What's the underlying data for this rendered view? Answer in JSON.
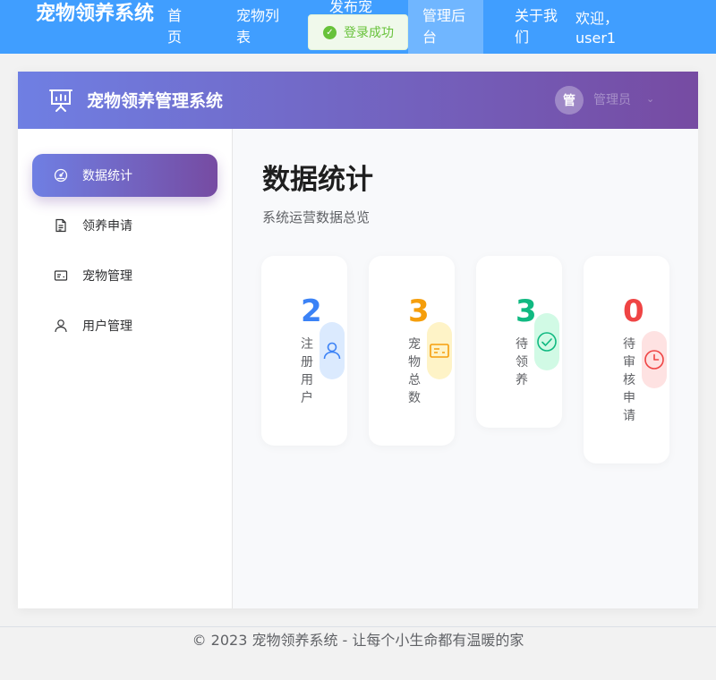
{
  "topbar": {
    "brand": "宠物领养系统",
    "nav": {
      "home": "首页",
      "pet_list": "宠物列表",
      "post_pet": "发布宠",
      "admin": "管理后台",
      "about": "关于我们"
    },
    "welcome": "欢迎，user1"
  },
  "toast": {
    "message": "登录成功",
    "icon": "check-circle-icon"
  },
  "app_header": {
    "title": "宠物领养管理系统",
    "avatar_text": "管",
    "admin_name": "管理员",
    "caret": "⌄"
  },
  "sidebar": {
    "items": [
      {
        "label": "数据统计",
        "icon": "dashboard-icon",
        "active": true
      },
      {
        "label": "领养申请",
        "icon": "document-icon",
        "active": false
      },
      {
        "label": "宠物管理",
        "icon": "card-icon",
        "active": false
      },
      {
        "label": "用户管理",
        "icon": "user-icon",
        "active": false
      }
    ]
  },
  "main": {
    "title": "数据统计",
    "subtitle": "系统运营数据总览",
    "stats": [
      {
        "value": "2",
        "label": "注册用户",
        "color": "#3b82f6",
        "icon_bg": "#dbeafe",
        "icon": "user-icon"
      },
      {
        "value": "3",
        "label": "宠物总数",
        "color": "#f59e0b",
        "icon_bg": "#fef3c7",
        "icon": "card-icon"
      },
      {
        "value": "3",
        "label": "待领养",
        "color": "#10b981",
        "icon_bg": "#d1fae5",
        "icon": "check-circle-icon"
      },
      {
        "value": "0",
        "label": "待审核申请",
        "color": "#ef4444",
        "icon_bg": "#fee2e2",
        "icon": "clock-icon"
      }
    ]
  },
  "footer": {
    "text": "© 2023 宠物领养系统 - 让每个小生命都有温暖的家"
  }
}
